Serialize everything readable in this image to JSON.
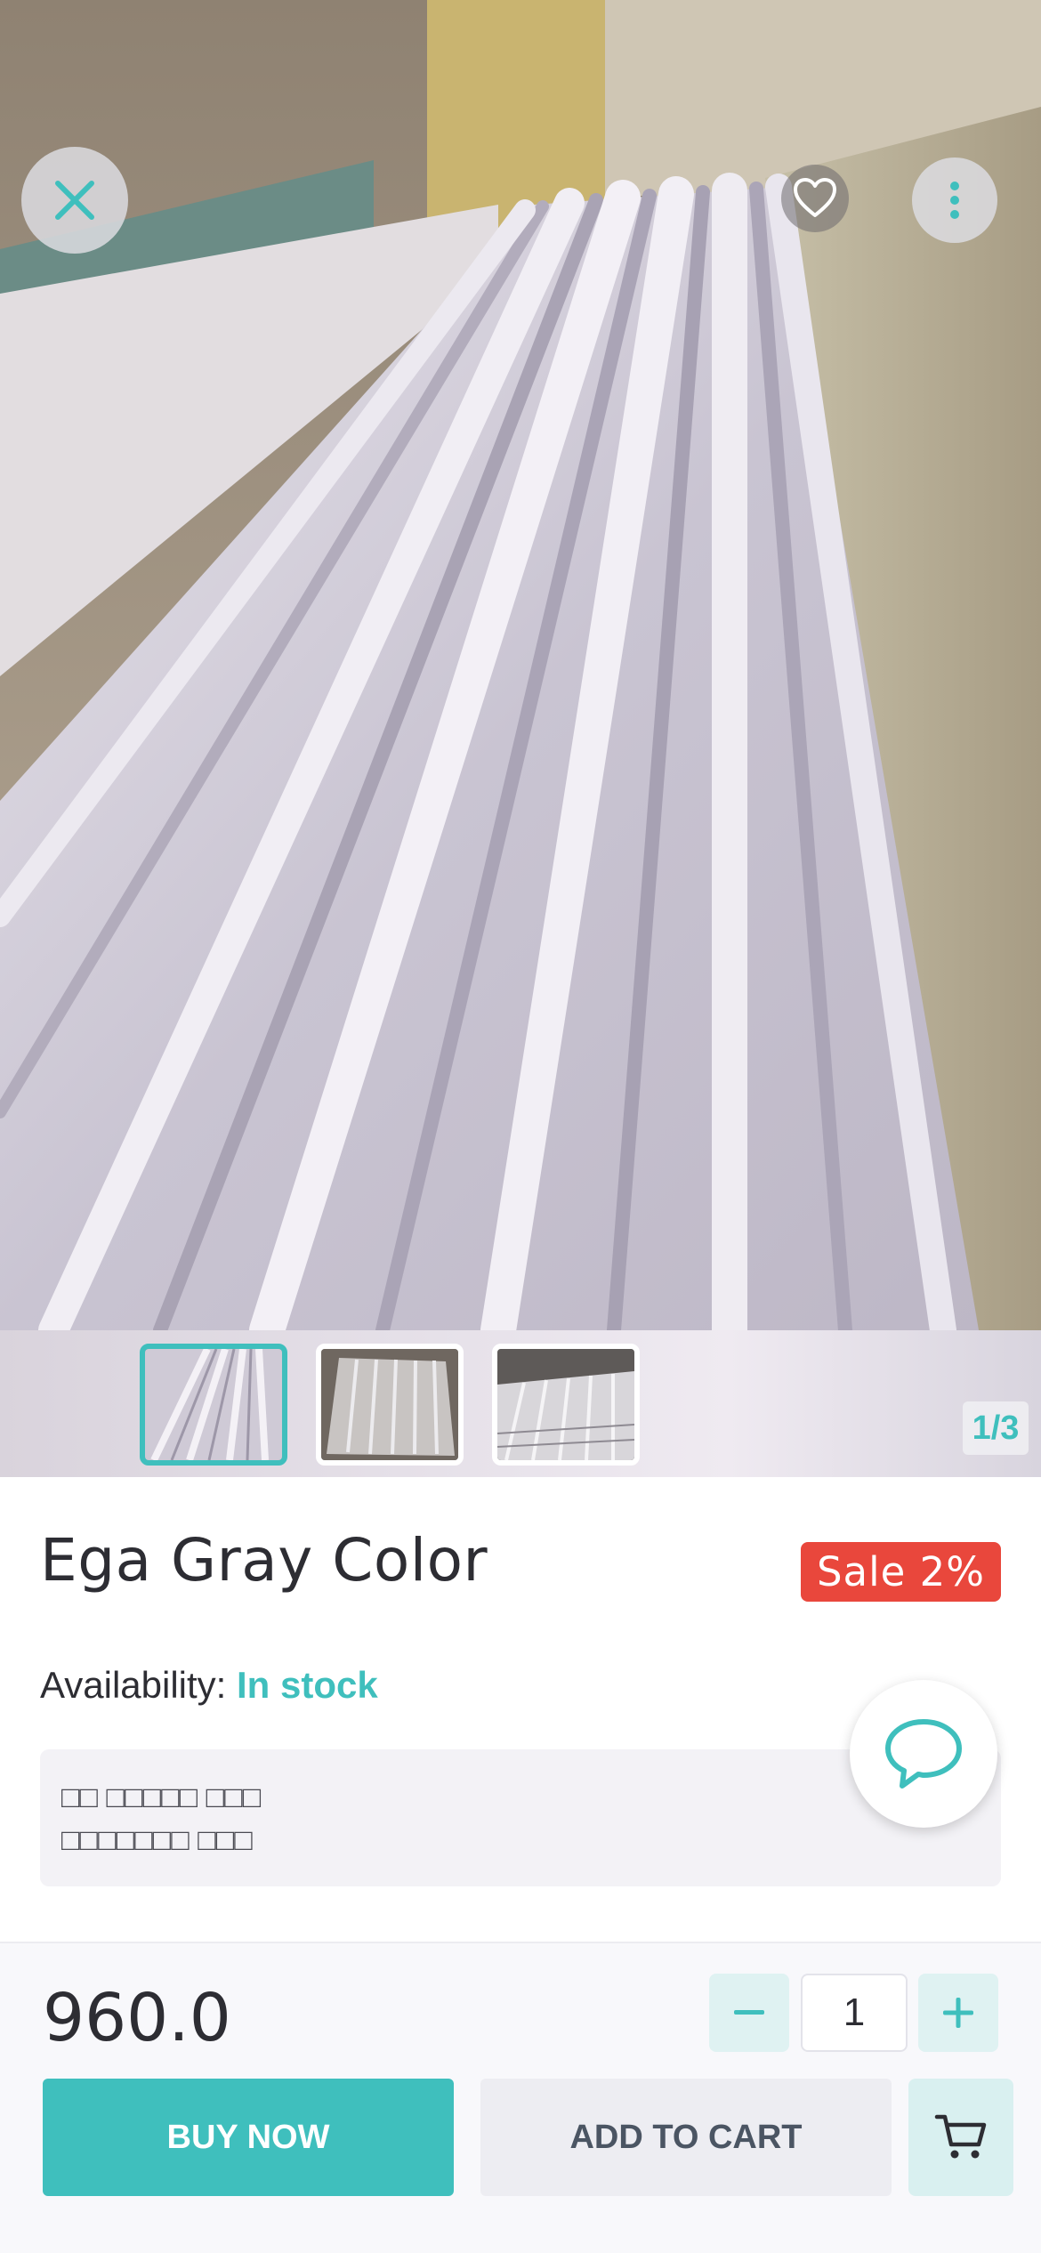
{
  "hero": {
    "image_alt": "Gray corrugated roofing sheets",
    "counter": "1/3",
    "thumbnails": [
      {
        "name": "thumbnail-1",
        "active": true
      },
      {
        "name": "thumbnail-2",
        "active": false
      },
      {
        "name": "thumbnail-3",
        "active": false
      }
    ]
  },
  "actions": {
    "close_icon": "close-icon",
    "favorite_icon": "heart-icon",
    "more_icon": "more-vertical-icon"
  },
  "product": {
    "title": "Ega Gray Color",
    "sale_badge": "Sale 2%",
    "availability_label": "Availability:",
    "availability_value": "In stock",
    "description_line1": "□□ □□□□□ □□□",
    "description_line2": "□□□□□□□ □□□"
  },
  "purchase": {
    "price": "960.0",
    "quantity": "1",
    "buy_now_label": "BUY NOW",
    "add_to_cart_label": "ADD TO CART"
  },
  "colors": {
    "accent": "#3fbfbd",
    "sale": "#e9473c",
    "text": "#2d2d33"
  }
}
